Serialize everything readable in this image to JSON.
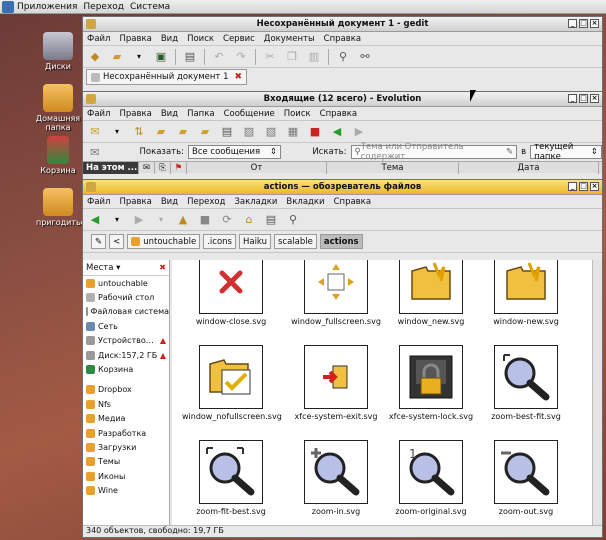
{
  "topbar": {
    "apps": "Приложения",
    "places": "Переход",
    "system": "Система"
  },
  "desktop": {
    "items": [
      {
        "label": "Диски",
        "color": "#8a8a9a",
        "icon": "drive-icon"
      },
      {
        "label": "Домашняя папка",
        "color": "#e8a030",
        "icon": "home-folder-icon"
      },
      {
        "label": "Корзина",
        "color": "#2e8a3e",
        "icon": "trash-icon"
      },
      {
        "label": "пригодиться",
        "color": "#e8a030",
        "icon": "folder-icon"
      }
    ]
  },
  "gedit": {
    "title": "Несохранённый документ 1 - gedit",
    "menu": [
      "Файл",
      "Правка",
      "Вид",
      "Поиск",
      "Сервис",
      "Документы",
      "Справка"
    ],
    "tab": "Несохранённый документ 1"
  },
  "evolution": {
    "title": "Входящие (12 всего) - Evolution",
    "menu": [
      "Файл",
      "Правка",
      "Вид",
      "Папка",
      "Сообщение",
      "Поиск",
      "Справка"
    ],
    "show_label": "Показать:",
    "show_value": "Все сообщения",
    "search_label": "Искать:",
    "search_placeholder": "Тема или Отправитель содержит",
    "in_label": "в",
    "scope_value": "текущей папке",
    "folder_header": "На этом ...",
    "columns": [
      "От",
      "Тема",
      "Дата"
    ]
  },
  "filemanager": {
    "title": "actions — обозреватель файлов",
    "menu": [
      "Файл",
      "Правка",
      "Вид",
      "Переход",
      "Закладки",
      "Вкладки",
      "Справка"
    ],
    "breadcrumbs": [
      "untouchable",
      ".icons",
      "Haiku",
      "scalable",
      "actions"
    ],
    "side_title": "Места",
    "places": [
      {
        "label": "untouchable",
        "color": "#e8a030"
      },
      {
        "label": "Рабочий стол",
        "color": "#b0b0b0"
      },
      {
        "label": "Файловая система",
        "color": "#909090"
      },
      {
        "label": "Сеть",
        "color": "#6a8ab0"
      },
      {
        "label": "Устройство…",
        "color": "#9a9a9a",
        "eject": true
      },
      {
        "label": "Диск:157,2 ГБ",
        "color": "#9a9a9a",
        "eject": true
      },
      {
        "label": "Корзина",
        "color": "#2e8a3e"
      }
    ],
    "bookmarks": [
      {
        "label": "Dropbox",
        "color": "#e8a030"
      },
      {
        "label": "Nfs",
        "color": "#e8a030"
      },
      {
        "label": "Медиа",
        "color": "#e8a030"
      },
      {
        "label": "Разработка",
        "color": "#e8a030"
      },
      {
        "label": "Загрузки",
        "color": "#e8a030"
      },
      {
        "label": "Темы",
        "color": "#e8a030"
      },
      {
        "label": "Иконы",
        "color": "#e8a030"
      },
      {
        "label": "Wine",
        "color": "#e8a030"
      }
    ],
    "files": [
      {
        "name": "window-close.svg",
        "icon": "close-x-icon"
      },
      {
        "name": "window_fullscreen.svg",
        "icon": "fullscreen-icon"
      },
      {
        "name": "window_new.svg",
        "icon": "new-window-icon"
      },
      {
        "name": "window-new.svg",
        "icon": "new-window-icon"
      },
      {
        "name": "window_nofullscreen.svg",
        "icon": "nofullscreen-icon"
      },
      {
        "name": "xfce-system-exit.svg",
        "icon": "exit-icon"
      },
      {
        "name": "xfce-system-lock.svg",
        "icon": "lock-icon"
      },
      {
        "name": "zoom-best-fit.svg",
        "icon": "zoom-best-fit-icon"
      },
      {
        "name": "zoom-fit-best.svg",
        "icon": "zoom-fit-best-icon"
      },
      {
        "name": "zoom-in.svg",
        "icon": "zoom-in-icon"
      },
      {
        "name": "zoom-original.svg",
        "icon": "zoom-original-icon"
      },
      {
        "name": "zoom-out.svg",
        "icon": "zoom-out-icon"
      }
    ],
    "status": "340 объектов, свободно: 19,7 ГБ"
  },
  "colors": {
    "folder": "#e8b030",
    "accent_title": "#f0c840",
    "close_red": "#d03030"
  }
}
